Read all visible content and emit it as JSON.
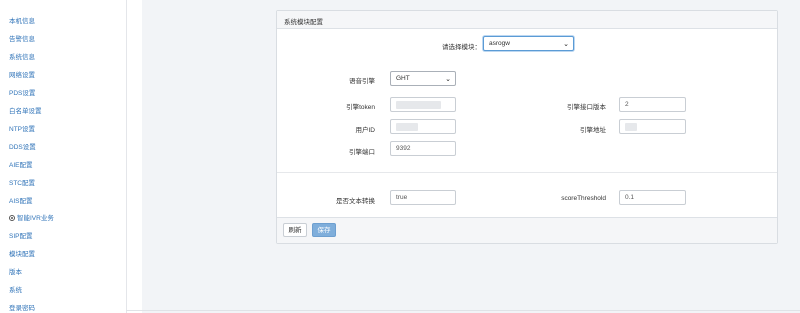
{
  "sidebar": {
    "items": [
      {
        "label": "本机信息"
      },
      {
        "label": "告警信息"
      },
      {
        "label": "系统信息"
      },
      {
        "label": "网络设置"
      },
      {
        "label": "PDS设置"
      },
      {
        "label": "白名单设置"
      },
      {
        "label": "NTP设置"
      },
      {
        "label": "DDS设置"
      },
      {
        "label": "AIE配置"
      },
      {
        "label": "STC配置"
      },
      {
        "label": "AIS配置"
      },
      {
        "label": "智能IVR业务",
        "icon": "circle-dot-icon"
      },
      {
        "label": "SIP配置"
      },
      {
        "label": "模块配置"
      },
      {
        "label": "版本"
      },
      {
        "label": "系统"
      },
      {
        "label": "登录密码"
      }
    ]
  },
  "panel": {
    "title": "系统模块配置",
    "module_select_label": "请选择模块：",
    "module_select_value": "asrogw",
    "fields": {
      "engine_label": "语音引擎",
      "engine_value": "GHT",
      "token_label": "引擎token",
      "port_version_label": "引擎接口版本",
      "port_version_value": "2",
      "user_id_label": "用户ID",
      "address_label": "引擎地址",
      "engine_port_label": "引擎端口",
      "engine_port_value": "9392",
      "text_convert_label": "是否文本转换",
      "text_convert_value": "true",
      "score_label": "scoreThreshold",
      "score_value": "0.1"
    },
    "buttons": {
      "refresh": "刷新",
      "save": "保存"
    }
  },
  "colors": {
    "link": "#2f73b8",
    "primary_button": "#7faedb",
    "page_bg": "#f2f4f7"
  }
}
